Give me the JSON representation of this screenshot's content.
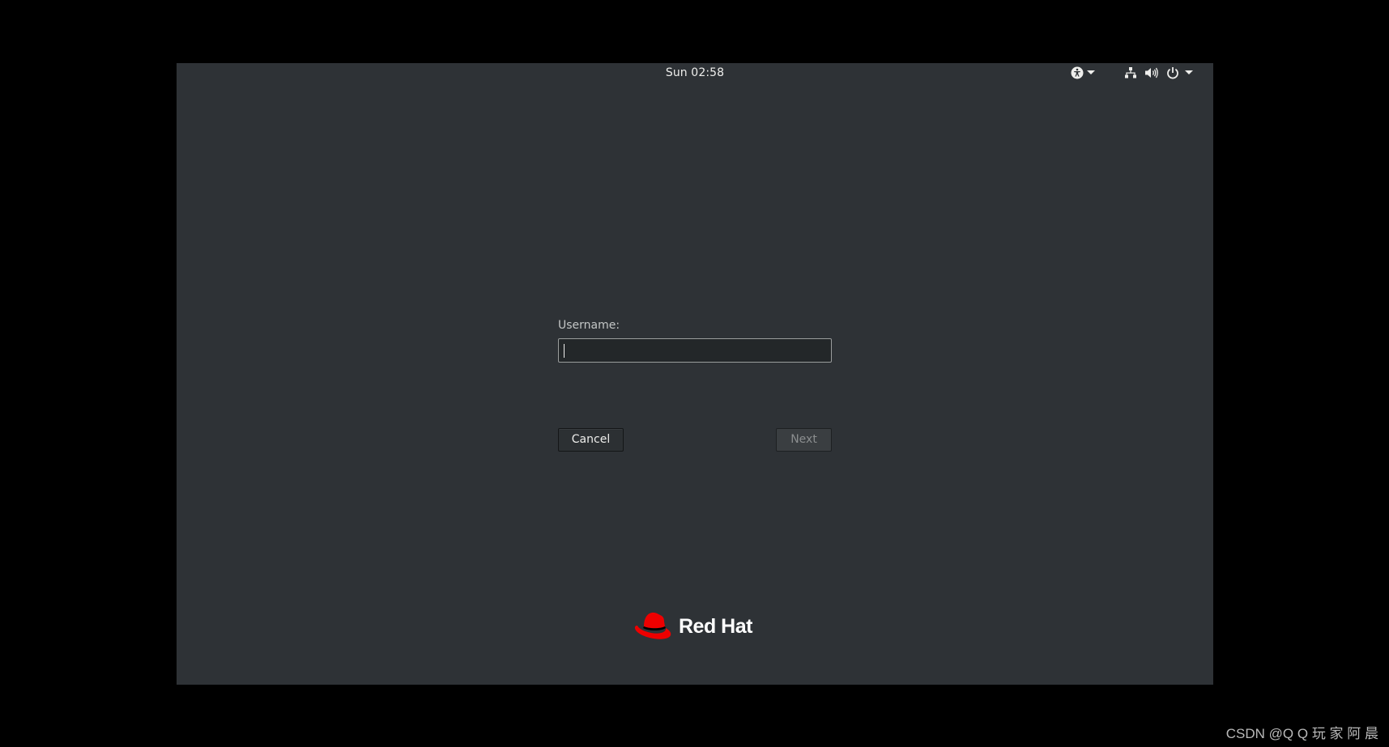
{
  "topbar": {
    "clock": "Sun 02:58",
    "icons": {
      "accessibility": "accessibility-icon",
      "network": "network-wired-icon",
      "volume": "volume-icon",
      "power": "power-icon",
      "dropdown": "chevron-down-icon"
    }
  },
  "login": {
    "username_label": "Username:",
    "username_value": "",
    "cancel_label": "Cancel",
    "next_label": "Next"
  },
  "branding": {
    "logo_text": "Red Hat",
    "logo_icon": "red-hat-logo-icon",
    "logo_color": "#ee0000"
  },
  "watermark": {
    "text": "CSDN @Q Q 玩 家 阿 晨"
  },
  "colors": {
    "background": "#2e3236",
    "outer": "#000000",
    "text": "#eeeeec"
  }
}
